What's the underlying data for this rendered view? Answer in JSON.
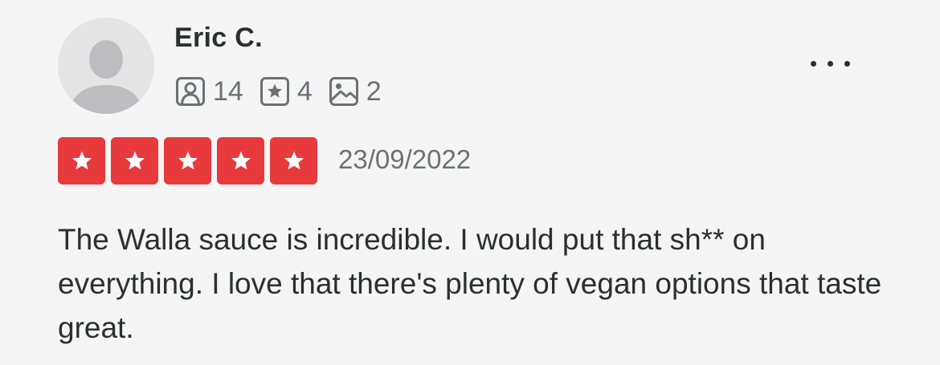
{
  "review": {
    "user": {
      "name": "Eric C.",
      "avatar_icon": "default-user-avatar-icon"
    },
    "stats": {
      "friends": {
        "icon": "friends-icon",
        "value": "14"
      },
      "reviews": {
        "icon": "review-star-icon",
        "value": "4"
      },
      "photos": {
        "icon": "photo-icon",
        "value": "2"
      }
    },
    "more_icon": "more-options-icon",
    "rating": {
      "value": 5,
      "max": 5,
      "color": "#e8393d"
    },
    "date": "23/09/2022",
    "text": "The Walla sauce is incredible. I would put that sh** on everything. I love that there's plenty of vegan options that taste great."
  }
}
